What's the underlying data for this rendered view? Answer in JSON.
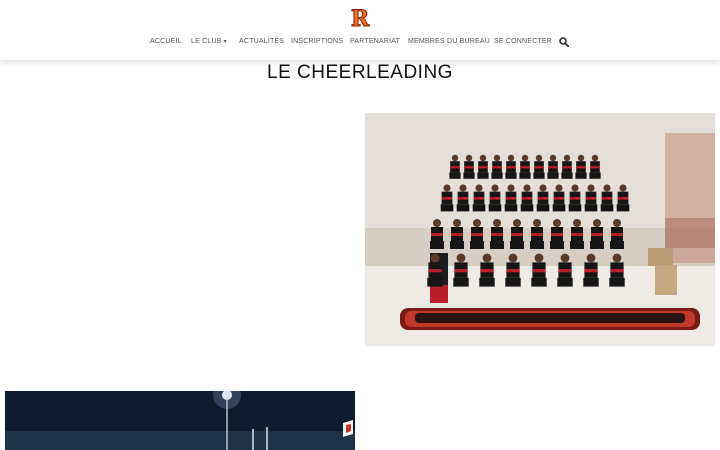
{
  "nav": {
    "items": [
      {
        "label": "ACCUEIL"
      },
      {
        "label": "LE CLUB"
      },
      {
        "label": "ACTUALITÉS"
      },
      {
        "label": "INSCRIPTIONS"
      },
      {
        "label": "PARTENARIAT"
      },
      {
        "label": "MEMBRES DU BUREAU"
      },
      {
        "label": "SE CONNECTER"
      }
    ],
    "dropdown_caret": "▾",
    "search_icon": "search-icon"
  },
  "logo": {
    "letter": "R",
    "colors": {
      "fill": "#e8741c",
      "outline": "#8b1a12"
    }
  },
  "page": {
    "title": "LE CHEERLEADING"
  },
  "colors": {
    "uniform_red": "#b51f2a",
    "uniform_black": "#161616",
    "night_sky": "#0d1a2b"
  }
}
